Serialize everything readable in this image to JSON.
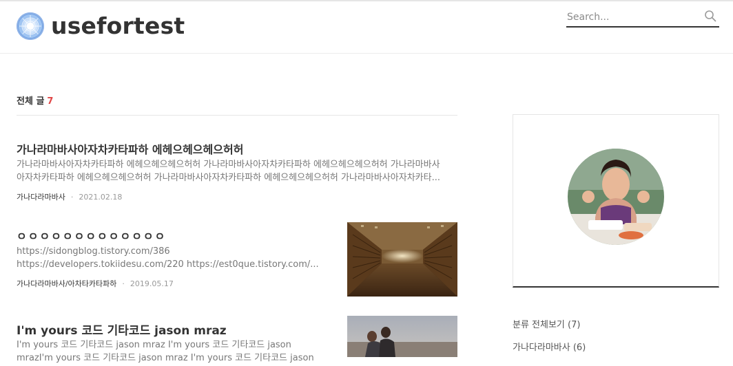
{
  "blog": {
    "name": "usefortest",
    "search_placeholder": "Search..."
  },
  "list": {
    "heading": "전체 글",
    "count": "7"
  },
  "posts": [
    {
      "title": "가나라마바사아자차카타파하 에헤으헤으헤으허허",
      "excerpt": "가나라마바사아자차카타파하 에헤으헤으헤으허허 가나라마바사아자차카타파하 에헤으헤으헤으허허 가나라마바사아자차카타파하 에헤으헤으헤으허허 가나라마바사아자차카타파하 에헤으헤으헤으허허 가나라마바사아자차카타...",
      "category": "가나다라마바사",
      "date": "2021.02.18"
    },
    {
      "title": "ㅇㅇㅇㅇㅇㅇㅇㅇㅇㅇㅇㅇㅇ",
      "excerpt": "https://sidongblog.tistory.com/386 https://developers.tokiidesu.com/220 https://est0que.tistory.com/...",
      "category": "가나다라마바사/아차타카타파하",
      "date": "2019.05.17"
    },
    {
      "title": "I'm yours 코드 기타코드 jason mraz",
      "excerpt": "I'm yours 코드 기타코드 jason mraz I'm yours 코드 기타코드 jason mrazI'm yours 코드 기타코드 jason mraz I'm yours 코드 기타코드 jason mraz"
    }
  ],
  "sidebar": {
    "categories": [
      {
        "label": "분류 전체보기 (7)"
      },
      {
        "label": "가나다라마바사 (6)"
      }
    ]
  }
}
